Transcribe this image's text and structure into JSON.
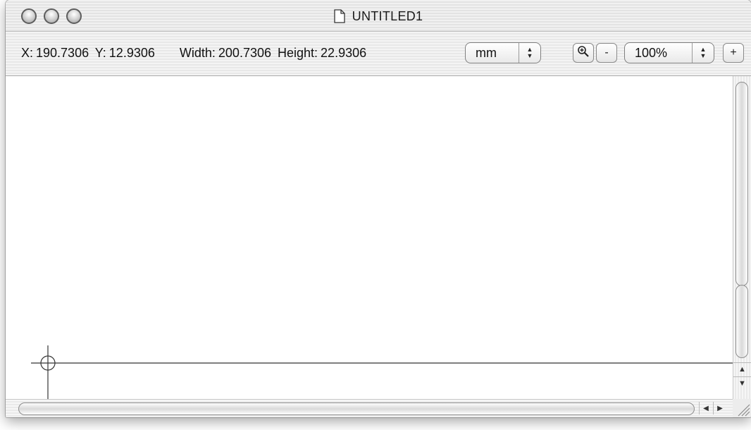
{
  "window": {
    "title": "UNTITLED1",
    "doc_icon": "document-icon"
  },
  "infobar": {
    "x_label": "X:",
    "x_value": "190.7306",
    "y_label": "Y:",
    "y_value": "12.9306",
    "width_label": "Width:",
    "width_value": "200.7306",
    "height_label": "Height:",
    "height_value": "22.9306",
    "unit": "mm",
    "zoom_tool_icon": "magnifier-plus-icon",
    "zoom_out_label": "-",
    "zoom_level": "100%",
    "zoom_in_label": "+"
  },
  "scrollbars": {
    "up_arrow": "▲",
    "down_arrow": "▼",
    "left_arrow": "◀",
    "right_arrow": "▶"
  }
}
